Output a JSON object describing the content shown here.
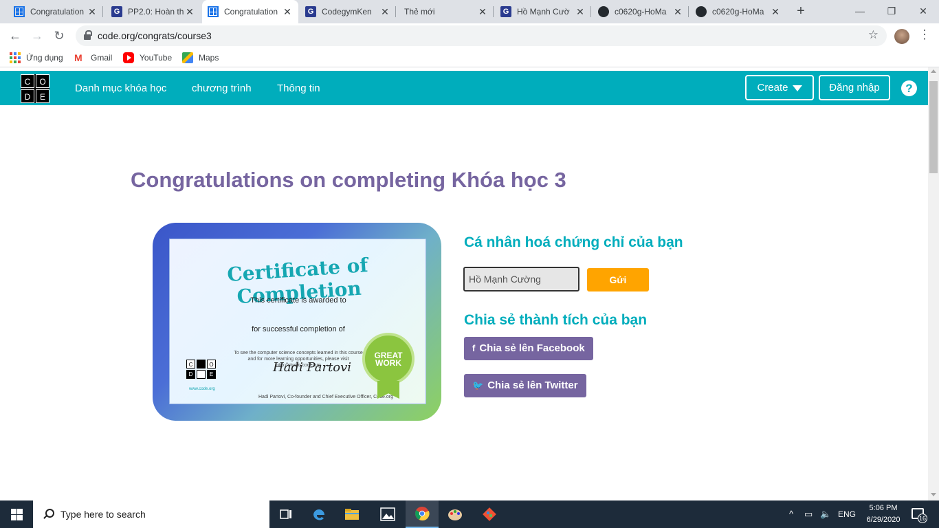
{
  "browser": {
    "tabs": [
      {
        "title": "Congratulation",
        "favicon": "code-org-icon",
        "active": false
      },
      {
        "title": "PP2.0: Hoàn th",
        "favicon": "codegym-icon",
        "active": false
      },
      {
        "title": "Congratulation",
        "favicon": "code-org-icon",
        "active": true
      },
      {
        "title": "CodegymKen",
        "favicon": "codegym-icon",
        "active": false
      },
      {
        "title": "Thẻ mới",
        "favicon": "none",
        "active": false
      },
      {
        "title": "Hồ Mạnh Cườ",
        "favicon": "codegym-icon",
        "active": false
      },
      {
        "title": "c0620g-HoMa",
        "favicon": "github-icon",
        "active": false
      },
      {
        "title": "c0620g-HoMa",
        "favicon": "github-icon",
        "active": false
      }
    ],
    "tab_close": "✕",
    "new_tab": "+",
    "window_controls": {
      "minimize": "—",
      "restore": "❐",
      "close": "✕"
    },
    "nav": {
      "back": "←",
      "forward": "→",
      "reload": "↻"
    },
    "url": "code.org/congrats/course3",
    "bookmark_star": "☆",
    "menu": "⋮",
    "bookmarks": [
      {
        "label": "Ứng dụng",
        "icon": "apps-grid-icon"
      },
      {
        "label": "Gmail",
        "icon": "gmail-icon"
      },
      {
        "label": "YouTube",
        "icon": "youtube-icon"
      },
      {
        "label": "Maps",
        "icon": "maps-icon"
      }
    ]
  },
  "site": {
    "logo_letters": [
      "C",
      "O",
      "D",
      "E"
    ],
    "nav": [
      "Danh mục khóa học",
      "chương trình",
      "Thông tin"
    ],
    "create_label": "Create",
    "login_label": "Đăng nhập",
    "help": "?",
    "accent": "#00adbc",
    "purple": "#7665a0",
    "orange": "#ffa400"
  },
  "main": {
    "title": "Congratulations on completing Khóa học 3",
    "certificate": {
      "heading": "Certificate of Completion",
      "awarded": "This certificate is awarded to",
      "completion": "for successful completion of",
      "small_text": [
        "To see the computer science concepts learned in this course",
        "and for more learning opportunities, please visit",
        "http://studio.code.org"
      ],
      "signature": "Hadi Partovi",
      "signer": "Hadi Partovi, Co-founder and Chief Executive Officer, Code.org",
      "logo_letters": [
        "C",
        "O",
        "D",
        "E"
      ],
      "url": "www.code.org",
      "badge": "GREAT WORK"
    },
    "personalize_title": "Cá nhân hoá chứng chỉ của bạn",
    "name_value": "Hồ Mạnh Cường",
    "submit_label": "Gửi",
    "share_title": "Chia sẻ thành tích của bạn",
    "share_facebook": "Chia sẻ lên Facebook",
    "share_twitter": "Chia sẻ lên Twitter"
  },
  "taskbar": {
    "search_placeholder": "Type here to search",
    "language": "ENG",
    "time": "5:06 PM",
    "date": "6/29/2020",
    "notifications": "16"
  }
}
